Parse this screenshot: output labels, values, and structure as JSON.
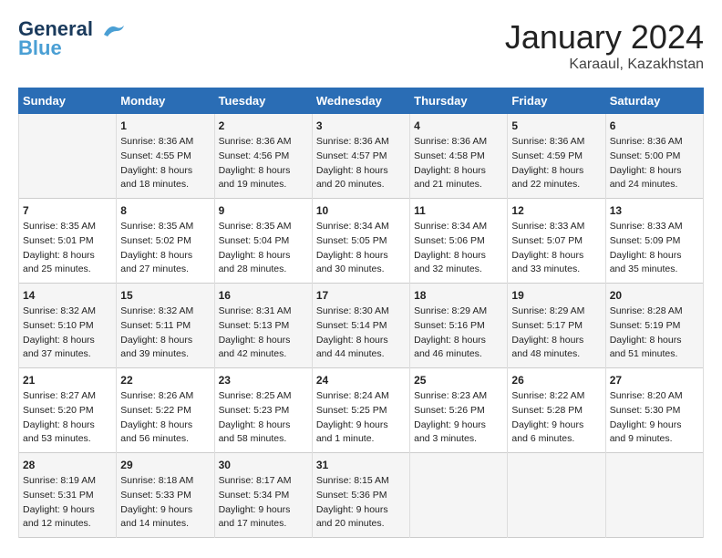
{
  "app": {
    "logo_line1": "General",
    "logo_line2": "Blue"
  },
  "title": "January 2024",
  "subtitle": "Karaaul, Kazakhstan",
  "days_of_week": [
    "Sunday",
    "Monday",
    "Tuesday",
    "Wednesday",
    "Thursday",
    "Friday",
    "Saturday"
  ],
  "weeks": [
    [
      {
        "day": "",
        "sunrise": "",
        "sunset": "",
        "daylight": ""
      },
      {
        "day": "1",
        "sunrise": "Sunrise: 8:36 AM",
        "sunset": "Sunset: 4:55 PM",
        "daylight": "Daylight: 8 hours and 18 minutes."
      },
      {
        "day": "2",
        "sunrise": "Sunrise: 8:36 AM",
        "sunset": "Sunset: 4:56 PM",
        "daylight": "Daylight: 8 hours and 19 minutes."
      },
      {
        "day": "3",
        "sunrise": "Sunrise: 8:36 AM",
        "sunset": "Sunset: 4:57 PM",
        "daylight": "Daylight: 8 hours and 20 minutes."
      },
      {
        "day": "4",
        "sunrise": "Sunrise: 8:36 AM",
        "sunset": "Sunset: 4:58 PM",
        "daylight": "Daylight: 8 hours and 21 minutes."
      },
      {
        "day": "5",
        "sunrise": "Sunrise: 8:36 AM",
        "sunset": "Sunset: 4:59 PM",
        "daylight": "Daylight: 8 hours and 22 minutes."
      },
      {
        "day": "6",
        "sunrise": "Sunrise: 8:36 AM",
        "sunset": "Sunset: 5:00 PM",
        "daylight": "Daylight: 8 hours and 24 minutes."
      }
    ],
    [
      {
        "day": "7",
        "sunrise": "Sunrise: 8:35 AM",
        "sunset": "Sunset: 5:01 PM",
        "daylight": "Daylight: 8 hours and 25 minutes."
      },
      {
        "day": "8",
        "sunrise": "Sunrise: 8:35 AM",
        "sunset": "Sunset: 5:02 PM",
        "daylight": "Daylight: 8 hours and 27 minutes."
      },
      {
        "day": "9",
        "sunrise": "Sunrise: 8:35 AM",
        "sunset": "Sunset: 5:04 PM",
        "daylight": "Daylight: 8 hours and 28 minutes."
      },
      {
        "day": "10",
        "sunrise": "Sunrise: 8:34 AM",
        "sunset": "Sunset: 5:05 PM",
        "daylight": "Daylight: 8 hours and 30 minutes."
      },
      {
        "day": "11",
        "sunrise": "Sunrise: 8:34 AM",
        "sunset": "Sunset: 5:06 PM",
        "daylight": "Daylight: 8 hours and 32 minutes."
      },
      {
        "day": "12",
        "sunrise": "Sunrise: 8:33 AM",
        "sunset": "Sunset: 5:07 PM",
        "daylight": "Daylight: 8 hours and 33 minutes."
      },
      {
        "day": "13",
        "sunrise": "Sunrise: 8:33 AM",
        "sunset": "Sunset: 5:09 PM",
        "daylight": "Daylight: 8 hours and 35 minutes."
      }
    ],
    [
      {
        "day": "14",
        "sunrise": "Sunrise: 8:32 AM",
        "sunset": "Sunset: 5:10 PM",
        "daylight": "Daylight: 8 hours and 37 minutes."
      },
      {
        "day": "15",
        "sunrise": "Sunrise: 8:32 AM",
        "sunset": "Sunset: 5:11 PM",
        "daylight": "Daylight: 8 hours and 39 minutes."
      },
      {
        "day": "16",
        "sunrise": "Sunrise: 8:31 AM",
        "sunset": "Sunset: 5:13 PM",
        "daylight": "Daylight: 8 hours and 42 minutes."
      },
      {
        "day": "17",
        "sunrise": "Sunrise: 8:30 AM",
        "sunset": "Sunset: 5:14 PM",
        "daylight": "Daylight: 8 hours and 44 minutes."
      },
      {
        "day": "18",
        "sunrise": "Sunrise: 8:29 AM",
        "sunset": "Sunset: 5:16 PM",
        "daylight": "Daylight: 8 hours and 46 minutes."
      },
      {
        "day": "19",
        "sunrise": "Sunrise: 8:29 AM",
        "sunset": "Sunset: 5:17 PM",
        "daylight": "Daylight: 8 hours and 48 minutes."
      },
      {
        "day": "20",
        "sunrise": "Sunrise: 8:28 AM",
        "sunset": "Sunset: 5:19 PM",
        "daylight": "Daylight: 8 hours and 51 minutes."
      }
    ],
    [
      {
        "day": "21",
        "sunrise": "Sunrise: 8:27 AM",
        "sunset": "Sunset: 5:20 PM",
        "daylight": "Daylight: 8 hours and 53 minutes."
      },
      {
        "day": "22",
        "sunrise": "Sunrise: 8:26 AM",
        "sunset": "Sunset: 5:22 PM",
        "daylight": "Daylight: 8 hours and 56 minutes."
      },
      {
        "day": "23",
        "sunrise": "Sunrise: 8:25 AM",
        "sunset": "Sunset: 5:23 PM",
        "daylight": "Daylight: 8 hours and 58 minutes."
      },
      {
        "day": "24",
        "sunrise": "Sunrise: 8:24 AM",
        "sunset": "Sunset: 5:25 PM",
        "daylight": "Daylight: 9 hours and 1 minute."
      },
      {
        "day": "25",
        "sunrise": "Sunrise: 8:23 AM",
        "sunset": "Sunset: 5:26 PM",
        "daylight": "Daylight: 9 hours and 3 minutes."
      },
      {
        "day": "26",
        "sunrise": "Sunrise: 8:22 AM",
        "sunset": "Sunset: 5:28 PM",
        "daylight": "Daylight: 9 hours and 6 minutes."
      },
      {
        "day": "27",
        "sunrise": "Sunrise: 8:20 AM",
        "sunset": "Sunset: 5:30 PM",
        "daylight": "Daylight: 9 hours and 9 minutes."
      }
    ],
    [
      {
        "day": "28",
        "sunrise": "Sunrise: 8:19 AM",
        "sunset": "Sunset: 5:31 PM",
        "daylight": "Daylight: 9 hours and 12 minutes."
      },
      {
        "day": "29",
        "sunrise": "Sunrise: 8:18 AM",
        "sunset": "Sunset: 5:33 PM",
        "daylight": "Daylight: 9 hours and 14 minutes."
      },
      {
        "day": "30",
        "sunrise": "Sunrise: 8:17 AM",
        "sunset": "Sunset: 5:34 PM",
        "daylight": "Daylight: 9 hours and 17 minutes."
      },
      {
        "day": "31",
        "sunrise": "Sunrise: 8:15 AM",
        "sunset": "Sunset: 5:36 PM",
        "daylight": "Daylight: 9 hours and 20 minutes."
      },
      {
        "day": "",
        "sunrise": "",
        "sunset": "",
        "daylight": ""
      },
      {
        "day": "",
        "sunrise": "",
        "sunset": "",
        "daylight": ""
      },
      {
        "day": "",
        "sunrise": "",
        "sunset": "",
        "daylight": ""
      }
    ]
  ]
}
